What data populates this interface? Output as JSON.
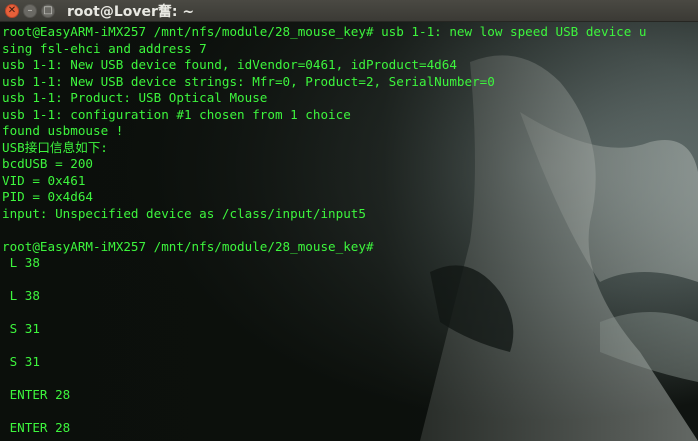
{
  "window": {
    "title": "root@Lover奮: ~",
    "close_glyph": "✕",
    "minimize_glyph": "–",
    "maximize_glyph": "□"
  },
  "terminal": {
    "text_color": "#3df53d",
    "lines": [
      "root@EasyARM-iMX257 /mnt/nfs/module/28_mouse_key# usb 1-1: new low speed USB device u",
      "sing fsl-ehci and address 7",
      "usb 1-1: New USB device found, idVendor=0461, idProduct=4d64",
      "usb 1-1: New USB device strings: Mfr=0, Product=2, SerialNumber=0",
      "usb 1-1: Product: USB Optical Mouse",
      "usb 1-1: configuration #1 chosen from 1 choice",
      "found usbmouse !",
      "USB接口信息如下:",
      "bcdUSB = 200",
      "VID = 0x461",
      "PID = 0x4d64",
      "input: Unspecified device as /class/input/input5",
      "",
      "root@EasyARM-iMX257 /mnt/nfs/module/28_mouse_key#",
      " L 38",
      "",
      " L 38",
      "",
      " S 31",
      "",
      " S 31",
      "",
      " ENTER 28",
      "",
      " ENTER 28"
    ]
  }
}
